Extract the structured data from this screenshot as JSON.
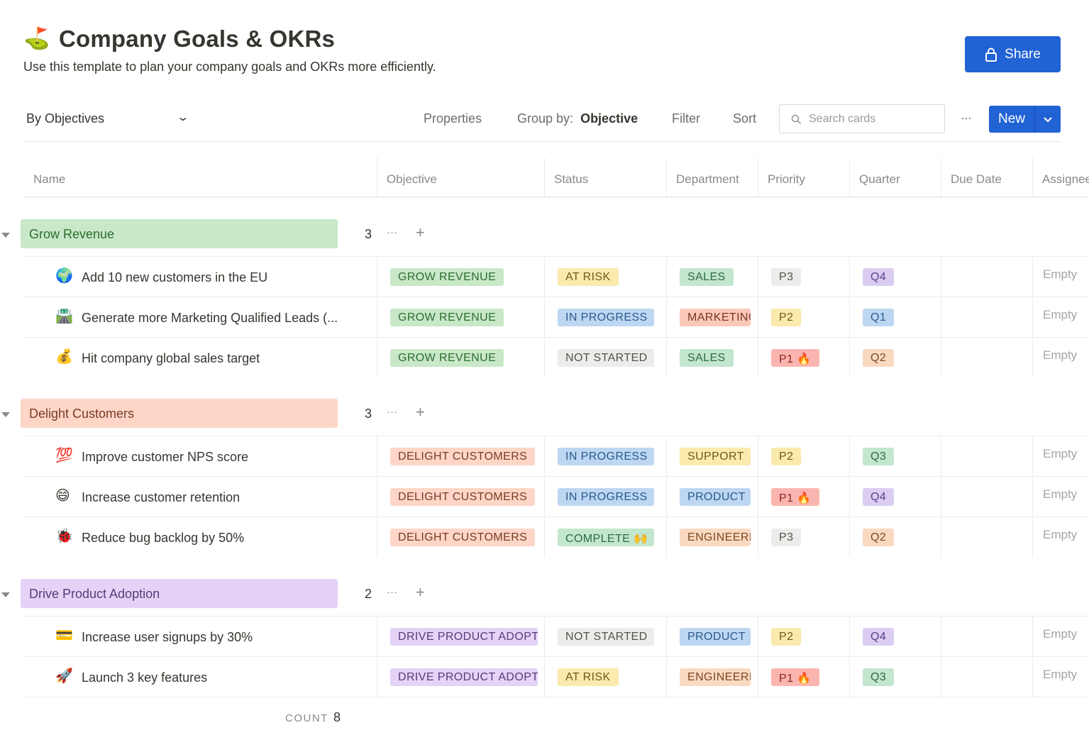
{
  "header": {
    "icon": "⛳",
    "title": "Company Goals & OKRs",
    "subtitle": "Use this template to plan your company goals and OKRs more efficiently.",
    "share_label": "Share",
    "share_icon": "lock-icon"
  },
  "toolbar": {
    "view": "By Objectives",
    "properties": "Properties",
    "group_by_label": "Group by:",
    "group_by_value": "Objective",
    "filter": "Filter",
    "sort": "Sort",
    "search_placeholder": "Search cards",
    "more": "···",
    "new_label": "New"
  },
  "columns": [
    "Name",
    "Objective",
    "Status",
    "Department",
    "Priority",
    "Quarter",
    "Due Date",
    "Assignee"
  ],
  "groups": [
    {
      "label": "Grow Revenue",
      "count": "3",
      "rows": [
        {
          "icon": "🌍",
          "name": "Add 10 new customers in the EU",
          "objective": "GROW REVENUE",
          "status": "AT RISK",
          "department": "SALES",
          "priority": "P3",
          "quarter": "Q4",
          "assignee": "Empty"
        },
        {
          "icon": "🛣️",
          "name": "Generate more Marketing Qualified Leads (...",
          "objective": "GROW REVENUE",
          "status": "IN PROGRESS",
          "department": "MARKETING",
          "priority": "P2",
          "quarter": "Q1",
          "assignee": "Empty"
        },
        {
          "icon": "💰",
          "name": "Hit company global sales target",
          "objective": "GROW REVENUE",
          "status": "NOT STARTED",
          "department": "SALES",
          "priority": "P1 🔥",
          "quarter": "Q2",
          "assignee": "Empty"
        }
      ]
    },
    {
      "label": "Delight Customers",
      "count": "3",
      "rows": [
        {
          "icon": "💯",
          "name": "Improve customer NPS score",
          "objective": "DELIGHT CUSTOMERS",
          "status": "IN PROGRESS",
          "department": "SUPPORT",
          "priority": "P2",
          "quarter": "Q3",
          "assignee": "Empty"
        },
        {
          "icon": "😄",
          "name": "Increase customer retention",
          "objective": "DELIGHT CUSTOMERS",
          "status": "IN PROGRESS",
          "department": "PRODUCT",
          "priority": "P1 🔥",
          "quarter": "Q4",
          "assignee": "Empty"
        },
        {
          "icon": "🐞",
          "name": "Reduce bug backlog by 50%",
          "objective": "DELIGHT CUSTOMERS",
          "status": "COMPLETE 🙌",
          "department": "ENGINEERING",
          "priority": "P3",
          "quarter": "Q2",
          "assignee": "Empty"
        }
      ]
    },
    {
      "label": "Drive Product Adoption",
      "count": "2",
      "rows": [
        {
          "icon": "💳",
          "name": "Increase user signups by 30%",
          "objective": "DRIVE PRODUCT ADOPTION",
          "status": "NOT STARTED",
          "department": "PRODUCT",
          "priority": "P2",
          "quarter": "Q4",
          "assignee": "Empty"
        },
        {
          "icon": "🚀",
          "name": "Launch 3 key features",
          "objective": "DRIVE PRODUCT ADOPTION",
          "status": "AT RISK",
          "department": "ENGINEERING",
          "priority": "P1 🔥",
          "quarter": "Q3",
          "assignee": "Empty"
        }
      ]
    }
  ],
  "footer": {
    "count_label": "COUNT",
    "count_value": "8"
  }
}
